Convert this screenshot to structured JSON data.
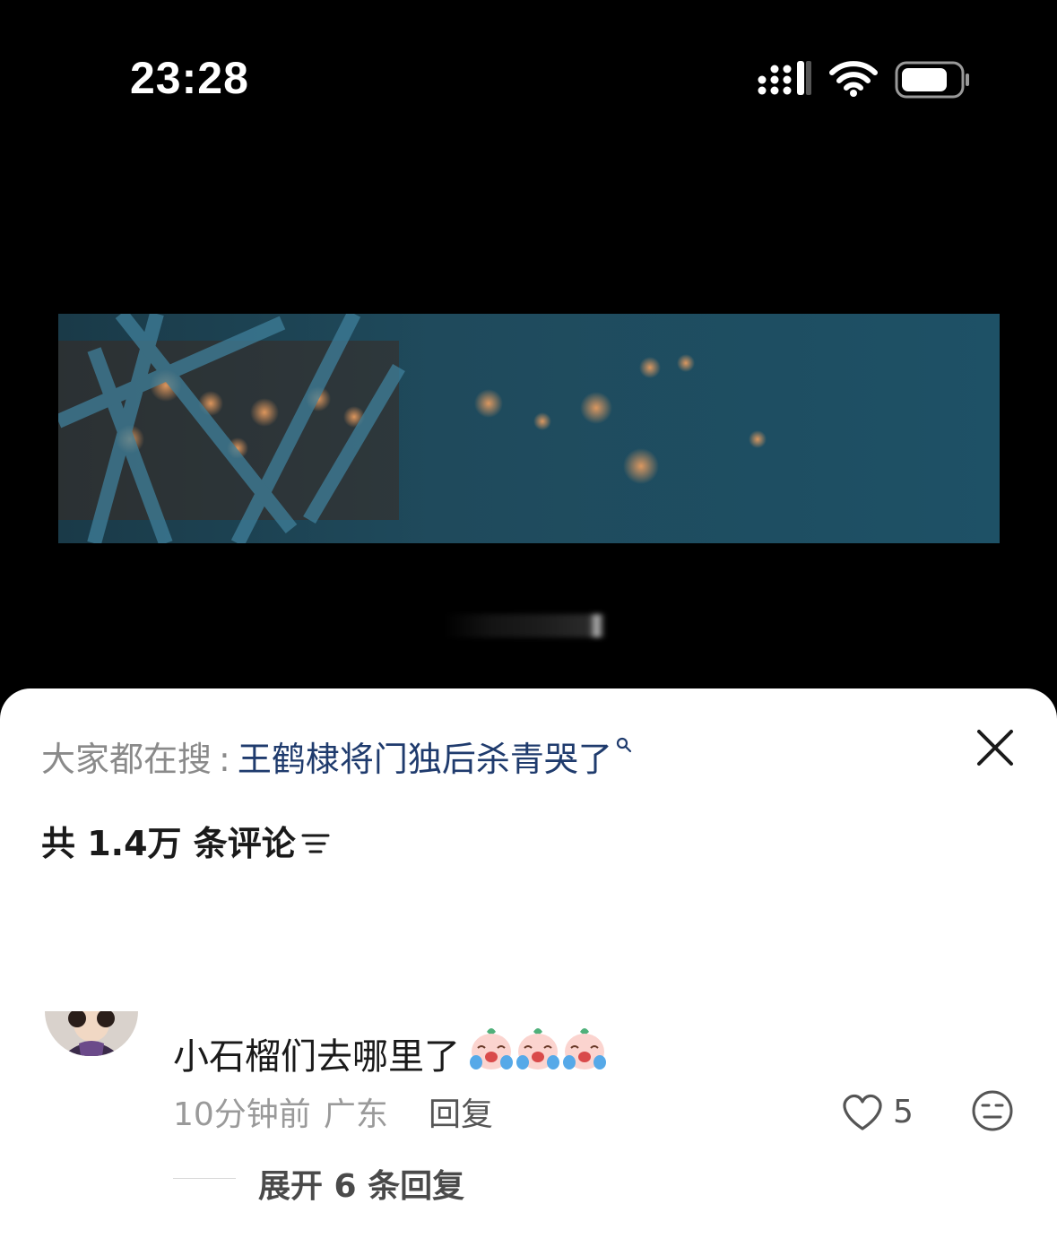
{
  "status_bar": {
    "time": "23:28",
    "icons": [
      "signal-icon",
      "wifi-icon",
      "battery-icon"
    ],
    "text_color": "#ffffff"
  },
  "video": {
    "frame_colors": [
      "#1c4a5e",
      "#27586c",
      "#8a4a22"
    ]
  },
  "comments_panel": {
    "search_prefix": "大家都在搜",
    "search_colon": ":",
    "search_term": "王鹤棣将门独后杀青哭了",
    "search_term_color": "#1f3b6d",
    "close_icon": "close-icon",
    "comment_count_label": "共 1.4万 条评论",
    "sort_icon": "sort-icon"
  },
  "comment": {
    "text": "小石榴们去哪里了",
    "emojis": [
      "crying-face-emoji",
      "crying-face-emoji",
      "crying-face-emoji"
    ],
    "time_ago": "10分钟前",
    "location": "广东",
    "reply_label": "回复",
    "like_count": "5",
    "like_icon": "heart-icon",
    "dislike_icon": "meh-face-icon",
    "expand_label": "展开 6 条回复"
  }
}
